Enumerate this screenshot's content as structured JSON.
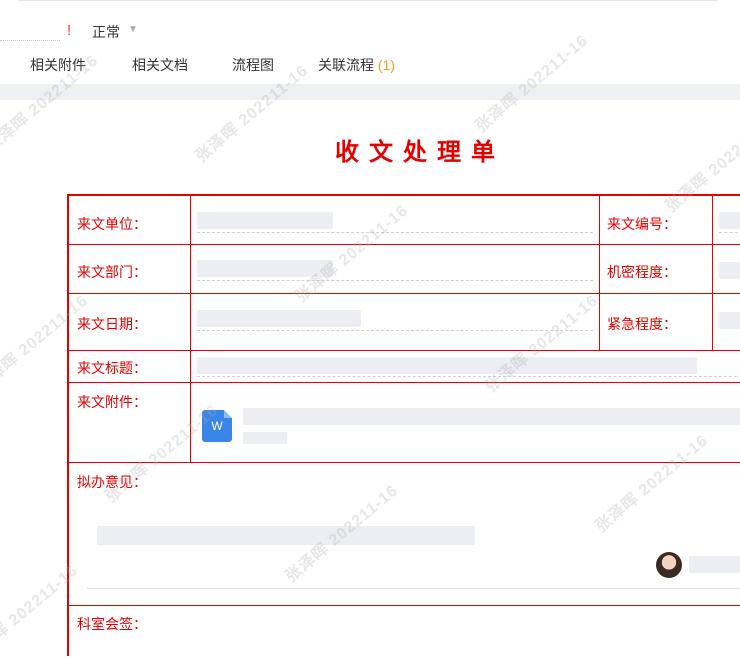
{
  "status": {
    "exclamation": "!",
    "priority": "正常",
    "caret": "▼"
  },
  "tabs": [
    {
      "label": "相关附件"
    },
    {
      "label": "相关文档"
    },
    {
      "label": "流程图"
    },
    {
      "label": "关联流程",
      "count": "(1)"
    }
  ],
  "doc": {
    "title": "收文处理单",
    "labels": {
      "sender_unit": "来文单位：",
      "sender_no": "来文编号：",
      "sender_dept": "来文部门：",
      "secret_level": "机密程度：",
      "date": "来文日期：",
      "urgency": "紧急程度：",
      "subject": "来文标题：",
      "attachment": "来文附件：",
      "opinion": "拟办意见：",
      "section_sign": "科室会签："
    },
    "attachment_icon_text": "W"
  },
  "watermark": "张泽晖 202211-16",
  "colors": {
    "accent_red": "#e60000",
    "count_orange": "#f0a020",
    "word_blue": "#3a86e8"
  }
}
